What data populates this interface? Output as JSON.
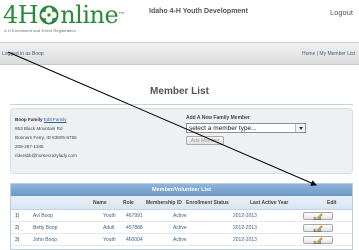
{
  "header": {
    "logo_text_left": "4H",
    "logo_text_right": "nline",
    "logo_tm": "™",
    "logo_tagline": "4-H Enrollment and Event Registration",
    "site_title": "Idaho 4-H Youth Development",
    "logout": "Logout"
  },
  "bar": {
    "logged_in": "Logged in as Boop",
    "links": "Home | My Member List"
  },
  "page": {
    "heading": "Member List"
  },
  "family": {
    "name": "Boop Family",
    "edit_link": "Edit Family",
    "address1": "853 Black Mountain Rd",
    "address2": "Bonners Ferry, ID 83805-5755",
    "phone": "208-267-1345",
    "email": "ridersbb@horsecrazylady.com"
  },
  "add_member": {
    "label": "Add A New Family Member",
    "select_value": "select a member type...",
    "button": "Add Member"
  },
  "table": {
    "title": "Member/Volunteer List",
    "columns": [
      "Name",
      "Role",
      "Membership ID",
      "Enrollment Status",
      "Last Active Year",
      "Edit"
    ],
    "rows": [
      {
        "idx": "1)",
        "name": "Avi Boop",
        "role": "Youth",
        "id": "467991",
        "status": "Active",
        "year": "2012-2013",
        "edit": "Edit"
      },
      {
        "idx": "2)",
        "name": "Betty Boop",
        "role": "Adult",
        "id": "457888",
        "status": "Active",
        "year": "2012-2013",
        "edit": "Edit"
      },
      {
        "idx": "3)",
        "name": "John Boop",
        "role": "Youth",
        "id": "460004",
        "status": "Active",
        "year": "2012-2013",
        "edit": "Edit"
      }
    ]
  },
  "colors": {
    "brand_green": "#2a8a3a",
    "link_blue": "#2a63a0",
    "table_header": "#7ea6d2"
  }
}
